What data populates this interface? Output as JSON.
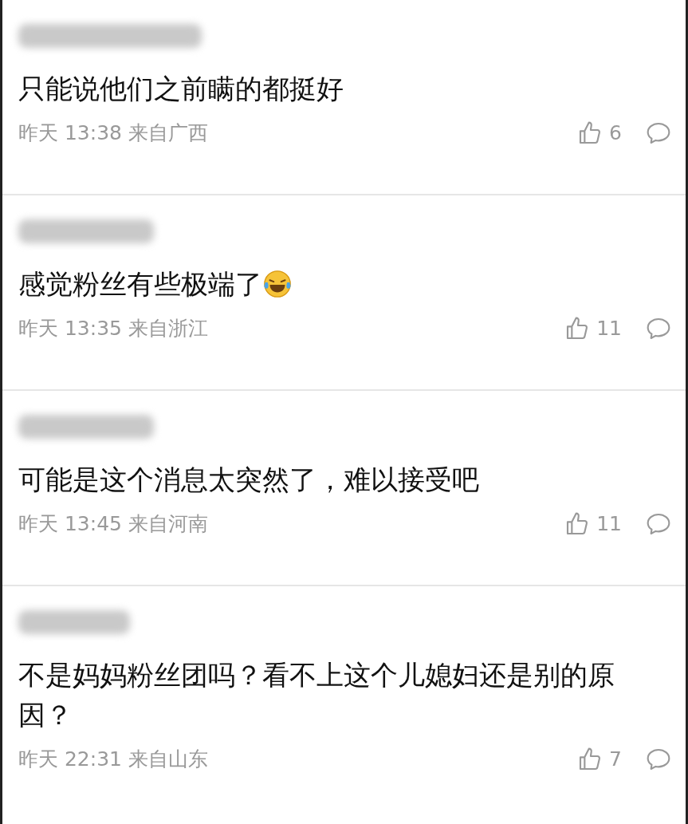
{
  "comments": [
    {
      "text": "只能说他们之前瞒的都挺好",
      "emoji": false,
      "time": "昨天 13:38",
      "location": "来自广西",
      "likes": "6"
    },
    {
      "text": "感觉粉丝有些极端了",
      "emoji": true,
      "time": "昨天 13:35",
      "location": "来自浙江",
      "likes": "11"
    },
    {
      "text": "可能是这个消息太突然了，难以接受吧",
      "emoji": false,
      "time": "昨天 13:45",
      "location": "来自河南",
      "likes": "11"
    },
    {
      "text": "不是妈妈粉丝团吗？看不上这个儿媳妇还是别的原因？",
      "emoji": false,
      "time": "昨天 22:31",
      "location": "来自山东",
      "likes": "7"
    }
  ]
}
